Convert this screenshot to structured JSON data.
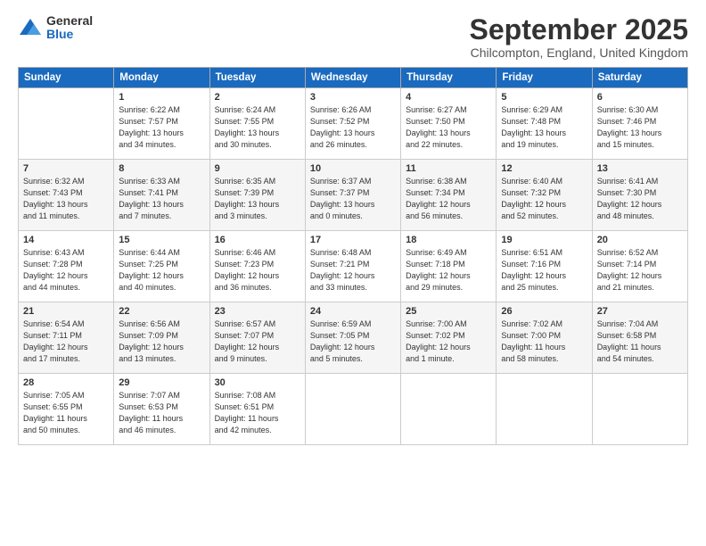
{
  "logo": {
    "general": "General",
    "blue": "Blue"
  },
  "header": {
    "month": "September 2025",
    "location": "Chilcompton, England, United Kingdom"
  },
  "days_of_week": [
    "Sunday",
    "Monday",
    "Tuesday",
    "Wednesday",
    "Thursday",
    "Friday",
    "Saturday"
  ],
  "weeks": [
    [
      {
        "day": "",
        "details": ""
      },
      {
        "day": "1",
        "details": "Sunrise: 6:22 AM\nSunset: 7:57 PM\nDaylight: 13 hours\nand 34 minutes."
      },
      {
        "day": "2",
        "details": "Sunrise: 6:24 AM\nSunset: 7:55 PM\nDaylight: 13 hours\nand 30 minutes."
      },
      {
        "day": "3",
        "details": "Sunrise: 6:26 AM\nSunset: 7:52 PM\nDaylight: 13 hours\nand 26 minutes."
      },
      {
        "day": "4",
        "details": "Sunrise: 6:27 AM\nSunset: 7:50 PM\nDaylight: 13 hours\nand 22 minutes."
      },
      {
        "day": "5",
        "details": "Sunrise: 6:29 AM\nSunset: 7:48 PM\nDaylight: 13 hours\nand 19 minutes."
      },
      {
        "day": "6",
        "details": "Sunrise: 6:30 AM\nSunset: 7:46 PM\nDaylight: 13 hours\nand 15 minutes."
      }
    ],
    [
      {
        "day": "7",
        "details": "Sunrise: 6:32 AM\nSunset: 7:43 PM\nDaylight: 13 hours\nand 11 minutes."
      },
      {
        "day": "8",
        "details": "Sunrise: 6:33 AM\nSunset: 7:41 PM\nDaylight: 13 hours\nand 7 minutes."
      },
      {
        "day": "9",
        "details": "Sunrise: 6:35 AM\nSunset: 7:39 PM\nDaylight: 13 hours\nand 3 minutes."
      },
      {
        "day": "10",
        "details": "Sunrise: 6:37 AM\nSunset: 7:37 PM\nDaylight: 13 hours\nand 0 minutes."
      },
      {
        "day": "11",
        "details": "Sunrise: 6:38 AM\nSunset: 7:34 PM\nDaylight: 12 hours\nand 56 minutes."
      },
      {
        "day": "12",
        "details": "Sunrise: 6:40 AM\nSunset: 7:32 PM\nDaylight: 12 hours\nand 52 minutes."
      },
      {
        "day": "13",
        "details": "Sunrise: 6:41 AM\nSunset: 7:30 PM\nDaylight: 12 hours\nand 48 minutes."
      }
    ],
    [
      {
        "day": "14",
        "details": "Sunrise: 6:43 AM\nSunset: 7:28 PM\nDaylight: 12 hours\nand 44 minutes."
      },
      {
        "day": "15",
        "details": "Sunrise: 6:44 AM\nSunset: 7:25 PM\nDaylight: 12 hours\nand 40 minutes."
      },
      {
        "day": "16",
        "details": "Sunrise: 6:46 AM\nSunset: 7:23 PM\nDaylight: 12 hours\nand 36 minutes."
      },
      {
        "day": "17",
        "details": "Sunrise: 6:48 AM\nSunset: 7:21 PM\nDaylight: 12 hours\nand 33 minutes."
      },
      {
        "day": "18",
        "details": "Sunrise: 6:49 AM\nSunset: 7:18 PM\nDaylight: 12 hours\nand 29 minutes."
      },
      {
        "day": "19",
        "details": "Sunrise: 6:51 AM\nSunset: 7:16 PM\nDaylight: 12 hours\nand 25 minutes."
      },
      {
        "day": "20",
        "details": "Sunrise: 6:52 AM\nSunset: 7:14 PM\nDaylight: 12 hours\nand 21 minutes."
      }
    ],
    [
      {
        "day": "21",
        "details": "Sunrise: 6:54 AM\nSunset: 7:11 PM\nDaylight: 12 hours\nand 17 minutes."
      },
      {
        "day": "22",
        "details": "Sunrise: 6:56 AM\nSunset: 7:09 PM\nDaylight: 12 hours\nand 13 minutes."
      },
      {
        "day": "23",
        "details": "Sunrise: 6:57 AM\nSunset: 7:07 PM\nDaylight: 12 hours\nand 9 minutes."
      },
      {
        "day": "24",
        "details": "Sunrise: 6:59 AM\nSunset: 7:05 PM\nDaylight: 12 hours\nand 5 minutes."
      },
      {
        "day": "25",
        "details": "Sunrise: 7:00 AM\nSunset: 7:02 PM\nDaylight: 12 hours\nand 1 minute."
      },
      {
        "day": "26",
        "details": "Sunrise: 7:02 AM\nSunset: 7:00 PM\nDaylight: 11 hours\nand 58 minutes."
      },
      {
        "day": "27",
        "details": "Sunrise: 7:04 AM\nSunset: 6:58 PM\nDaylight: 11 hours\nand 54 minutes."
      }
    ],
    [
      {
        "day": "28",
        "details": "Sunrise: 7:05 AM\nSunset: 6:55 PM\nDaylight: 11 hours\nand 50 minutes."
      },
      {
        "day": "29",
        "details": "Sunrise: 7:07 AM\nSunset: 6:53 PM\nDaylight: 11 hours\nand 46 minutes."
      },
      {
        "day": "30",
        "details": "Sunrise: 7:08 AM\nSunset: 6:51 PM\nDaylight: 11 hours\nand 42 minutes."
      },
      {
        "day": "",
        "details": ""
      },
      {
        "day": "",
        "details": ""
      },
      {
        "day": "",
        "details": ""
      },
      {
        "day": "",
        "details": ""
      }
    ]
  ]
}
